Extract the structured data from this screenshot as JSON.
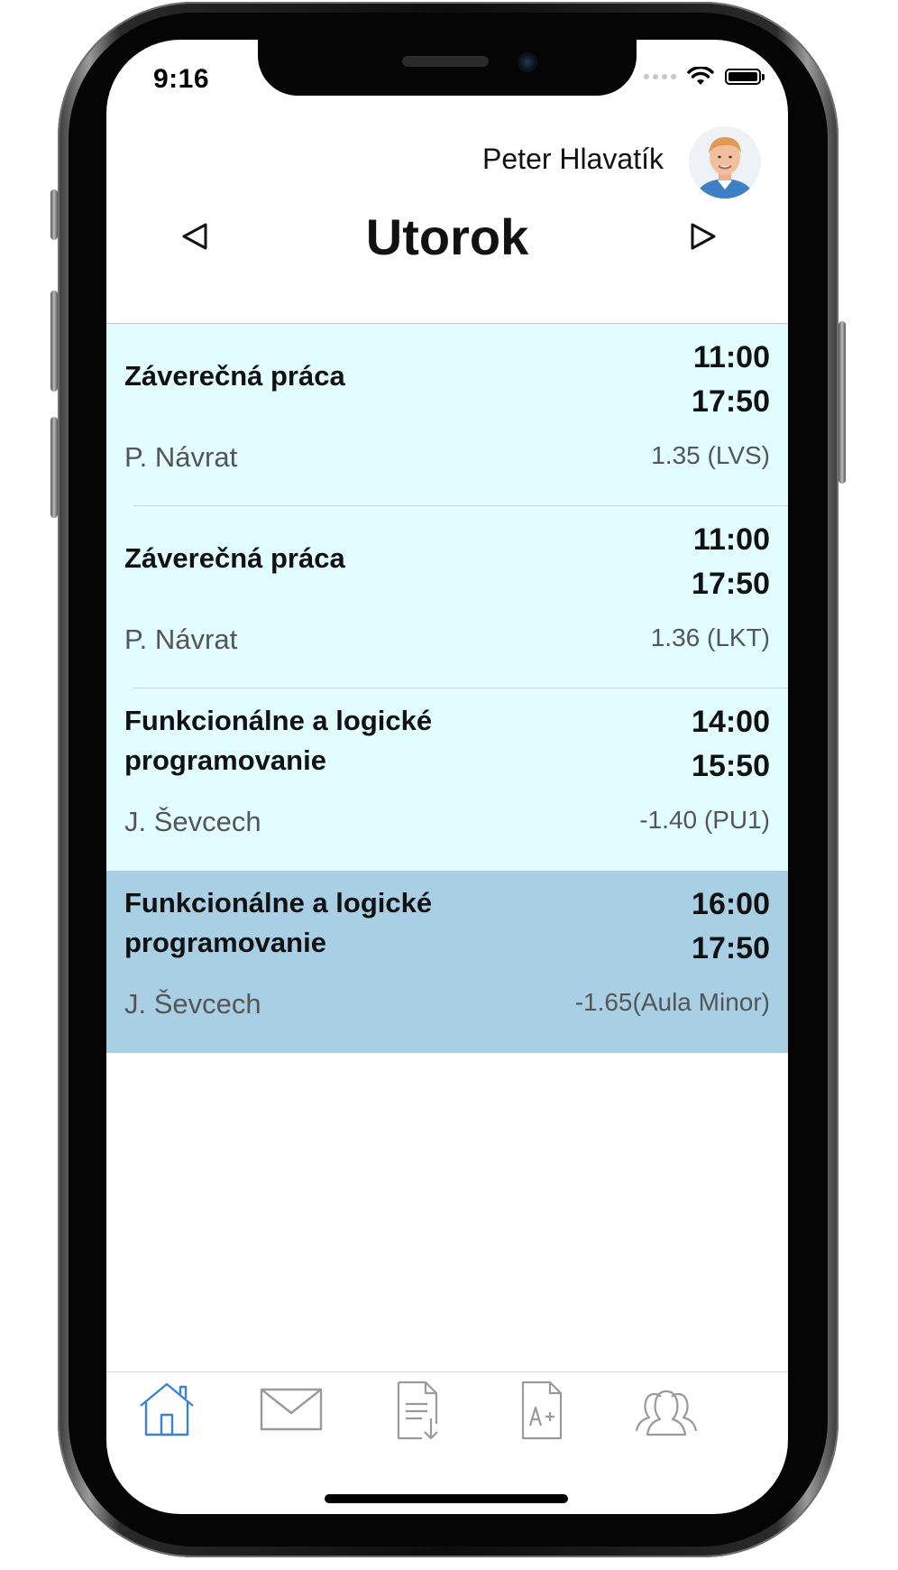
{
  "status_bar": {
    "time": "9:16"
  },
  "header": {
    "user_name": "Peter Hlavatík",
    "day_title": "Utorok"
  },
  "lessons": [
    {
      "subject": "Záverečná práca",
      "time_start": "11:00",
      "time_end": "17:50",
      "teacher": "P. Návrat",
      "room": "1.35 (LVS)",
      "highlighted": false
    },
    {
      "subject": "Záverečná práca",
      "time_start": "11:00",
      "time_end": "17:50",
      "teacher": "P. Návrat",
      "room": "1.36 (LKT)",
      "highlighted": false
    },
    {
      "subject": "Funkcionálne a logické programovanie",
      "time_start": "14:00",
      "time_end": "15:50",
      "teacher": "J. Ševcech",
      "room": "-1.40 (PU1)",
      "highlighted": false
    },
    {
      "subject": "Funkcionálne a logické programovanie",
      "time_start": "16:00",
      "time_end": "17:50",
      "teacher": "J. Ševcech",
      "room": "-1.65(Aula Minor)",
      "highlighted": true
    }
  ],
  "tabs": [
    {
      "icon": "home-icon",
      "active": true
    },
    {
      "icon": "mail-icon",
      "active": false
    },
    {
      "icon": "document-download-icon",
      "active": false
    },
    {
      "icon": "grades-icon",
      "active": false,
      "glyph_text": "A+"
    },
    {
      "icon": "people-icon",
      "active": false
    }
  ],
  "colors": {
    "row_background": "#e2fdff",
    "row_highlight": "#a8cfe4",
    "tab_active": "#3b82d6",
    "tab_inactive": "#9a9a9a"
  }
}
